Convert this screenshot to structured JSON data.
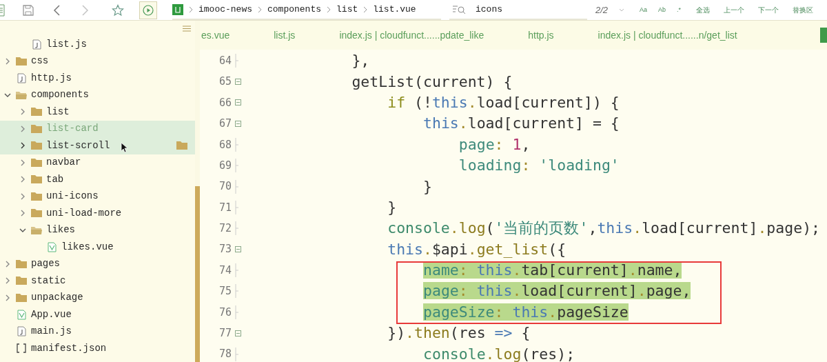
{
  "toolbar": {
    "breadcrumb": [
      "imooc-news",
      "components",
      "list",
      "list.vue"
    ]
  },
  "search": {
    "value": "icons",
    "count": "2/2",
    "options": [
      "Aa",
      "Ab",
      ".*"
    ],
    "buttons": [
      "全选",
      "上一个",
      "下一个",
      "替换区"
    ]
  },
  "explorer": {
    "tree": [
      {
        "children": [
          {
            "children": [
              {
                "label": "list.js",
                "kind": "js",
                "selected": false,
                "hovered": false
              }
            ]
          },
          {
            "label": "css",
            "kind": "folder",
            "expanded": false,
            "selected": false,
            "hovered": false
          },
          {
            "label": "http.js",
            "kind": "js",
            "selected": false,
            "hovered": false
          }
        ]
      },
      {
        "label": "components",
        "kind": "folder",
        "expanded": true,
        "selected": false,
        "hovered": false,
        "children": [
          {
            "label": "list",
            "kind": "folder",
            "expanded": false,
            "selected": false,
            "hovered": false
          },
          {
            "label": "list-card",
            "kind": "folder",
            "expanded": false,
            "selected": true,
            "hovered": false
          },
          {
            "label": "list-scroll",
            "kind": "folder",
            "expanded": false,
            "selected": false,
            "hovered": true
          },
          {
            "label": "navbar",
            "kind": "folder",
            "expanded": false,
            "selected": false,
            "hovered": false
          },
          {
            "label": "tab",
            "kind": "folder",
            "expanded": false,
            "selected": false,
            "hovered": false
          },
          {
            "label": "uni-icons",
            "kind": "folder",
            "expanded": false,
            "selected": false,
            "hovered": false
          },
          {
            "label": "uni-load-more",
            "kind": "folder",
            "expanded": false,
            "selected": false,
            "hovered": false
          },
          {
            "label": "likes",
            "kind": "folder",
            "expanded": true,
            "selected": false,
            "hovered": false,
            "children": [
              {
                "label": "likes.vue",
                "kind": "vue",
                "selected": false,
                "hovered": false
              }
            ]
          }
        ]
      },
      {
        "label": "pages",
        "kind": "folder",
        "expanded": false,
        "selected": false,
        "hovered": false
      },
      {
        "label": "static",
        "kind": "folder",
        "expanded": false,
        "selected": false,
        "hovered": false
      },
      {
        "label": "unpackage",
        "kind": "folder",
        "expanded": false,
        "selected": false,
        "hovered": false
      },
      {
        "label": "App.vue",
        "kind": "vue",
        "selected": false,
        "hovered": false
      },
      {
        "label": "main.js",
        "kind": "js",
        "selected": false,
        "hovered": false
      },
      {
        "label": "manifest.json",
        "kind": "json",
        "selected": false,
        "hovered": false
      }
    ]
  },
  "editor_tabs": [
    {
      "label": "es.vue",
      "selected": false
    },
    {
      "label": "list.js",
      "selected": false
    },
    {
      "label": "index.js | cloudfunct......pdate_like",
      "selected": false
    },
    {
      "label": "http.js",
      "selected": false
    },
    {
      "label": "index.js | cloudfunct......n/get_list",
      "selected": false
    }
  ],
  "code": [
    {
      "children": [
        {
          "children": [
            {
              "children": [
                {
                  "number": "64",
                  "foldable": false,
                  "selected": false,
                  "tokens": [
                    {
                      "kind": "plain",
                      "text": "},"
                    }
                  ]
                },
                {
                  "number": "65",
                  "foldable": true,
                  "selected": false,
                  "tokens": [
                    {
                      "kind": "plain",
                      "text": "getList(current) {"
                    }
                  ],
                  "children": [
                    {
                      "number": "66",
                      "foldable": true,
                      "selected": false,
                      "tokens": [
                        {
                          "kind": "control",
                          "text": "if"
                        },
                        {
                          "kind": "plain",
                          "text": " (!"
                        },
                        {
                          "kind": "this",
                          "text": "this"
                        },
                        {
                          "kind": "punct",
                          "text": "."
                        },
                        {
                          "kind": "plain",
                          "text": "load[current]) {"
                        }
                      ],
                      "children": [
                        {
                          "number": "67",
                          "foldable": true,
                          "selected": false,
                          "tokens": [
                            {
                              "kind": "this",
                              "text": "this"
                            },
                            {
                              "kind": "punct",
                              "text": "."
                            },
                            {
                              "kind": "plain",
                              "text": "load[current] = {"
                            }
                          ],
                          "children": [
                            {
                              "number": "68",
                              "foldable": false,
                              "selected": false,
                              "tokens": [
                                {
                                  "kind": "prop",
                                  "text": "page"
                                },
                                {
                                  "kind": "punct",
                                  "text": ":"
                                },
                                {
                                  "kind": "number",
                                  "text": " 1"
                                },
                                {
                                  "kind": "plain",
                                  "text": ","
                                }
                              ]
                            },
                            {
                              "number": "69",
                              "foldable": false,
                              "selected": false,
                              "tokens": [
                                {
                                  "kind": "prop",
                                  "text": "loading"
                                },
                                {
                                  "kind": "punct",
                                  "text": ":"
                                },
                                {
                                  "kind": "string",
                                  "text": " 'loading'"
                                }
                              ]
                            }
                          ]
                        },
                        {
                          "number": "70",
                          "foldable": false,
                          "selected": false,
                          "tokens": [
                            {
                              "kind": "plain",
                              "text": "}"
                            }
                          ]
                        }
                      ]
                    },
                    {
                      "number": "71",
                      "foldable": false,
                      "selected": false,
                      "tokens": [
                        {
                          "kind": "plain",
                          "text": "}"
                        }
                      ]
                    },
                    {
                      "number": "72",
                      "foldable": false,
                      "selected": false,
                      "tokens": [
                        {
                          "kind": "object",
                          "text": "console"
                        },
                        {
                          "kind": "punct",
                          "text": "."
                        },
                        {
                          "kind": "method",
                          "text": "log"
                        },
                        {
                          "kind": "plain",
                          "text": "("
                        },
                        {
                          "kind": "string",
                          "text": "'当前的页数'"
                        },
                        {
                          "kind": "plain",
                          "text": ","
                        },
                        {
                          "kind": "this",
                          "text": "this"
                        },
                        {
                          "kind": "punct",
                          "text": "."
                        },
                        {
                          "kind": "plain",
                          "text": "load[current]"
                        },
                        {
                          "kind": "punct",
                          "text": "."
                        },
                        {
                          "kind": "plain",
                          "text": "page);"
                        }
                      ]
                    },
                    {
                      "number": "73",
                      "foldable": true,
                      "selected": false,
                      "tokens": [
                        {
                          "kind": "this",
                          "text": "this"
                        },
                        {
                          "kind": "punct",
                          "text": "."
                        },
                        {
                          "kind": "plain",
                          "text": "$api"
                        },
                        {
                          "kind": "punct",
                          "text": "."
                        },
                        {
                          "kind": "method",
                          "text": "get_list"
                        },
                        {
                          "kind": "plain",
                          "text": "({"
                        }
                      ],
                      "children": [
                        {
                          "number": "74",
                          "foldable": false,
                          "selected": true,
                          "tokens": [
                            {
                              "kind": "prop",
                              "text": "name"
                            },
                            {
                              "kind": "punct",
                              "text": ":"
                            },
                            {
                              "kind": "this",
                              "text": " this"
                            },
                            {
                              "kind": "punct",
                              "text": "."
                            },
                            {
                              "kind": "plain",
                              "text": "tab[current]"
                            },
                            {
                              "kind": "punct",
                              "text": "."
                            },
                            {
                              "kind": "plain",
                              "text": "name,"
                            }
                          ]
                        },
                        {
                          "number": "75",
                          "foldable": false,
                          "selected": true,
                          "tokens": [
                            {
                              "kind": "prop",
                              "text": "page"
                            },
                            {
                              "kind": "punct",
                              "text": ":"
                            },
                            {
                              "kind": "this",
                              "text": " this"
                            },
                            {
                              "kind": "punct",
                              "text": "."
                            },
                            {
                              "kind": "plain",
                              "text": "load[current]"
                            },
                            {
                              "kind": "punct",
                              "text": "."
                            },
                            {
                              "kind": "plain",
                              "text": "page,"
                            }
                          ]
                        },
                        {
                          "number": "76",
                          "foldable": false,
                          "selected": true,
                          "tokens": [
                            {
                              "kind": "prop",
                              "text": "pageSize"
                            },
                            {
                              "kind": "punct",
                              "text": ":"
                            },
                            {
                              "kind": "this",
                              "text": " this"
                            },
                            {
                              "kind": "punct",
                              "text": "."
                            },
                            {
                              "kind": "plain",
                              "text": "pageSize"
                            }
                          ]
                        }
                      ]
                    },
                    {
                      "number": "77",
                      "foldable": true,
                      "selected": false,
                      "tokens": [
                        {
                          "kind": "plain",
                          "text": "})"
                        },
                        {
                          "kind": "punct",
                          "text": "."
                        },
                        {
                          "kind": "method",
                          "text": "then"
                        },
                        {
                          "kind": "plain",
                          "text": "(res "
                        },
                        {
                          "kind": "arrow",
                          "text": "=>"
                        },
                        {
                          "kind": "plain",
                          "text": " {"
                        }
                      ],
                      "children": [
                        {
                          "number": "78",
                          "foldable": false,
                          "selected": false,
                          "tokens": [
                            {
                              "kind": "object",
                              "text": "console"
                            },
                            {
                              "kind": "punct",
                              "text": "."
                            },
                            {
                              "kind": "method",
                              "text": "log"
                            },
                            {
                              "kind": "plain",
                              "text": "(res);"
                            }
                          ]
                        }
                      ]
                    }
                  ]
                }
              ]
            }
          ]
        }
      ]
    }
  ]
}
